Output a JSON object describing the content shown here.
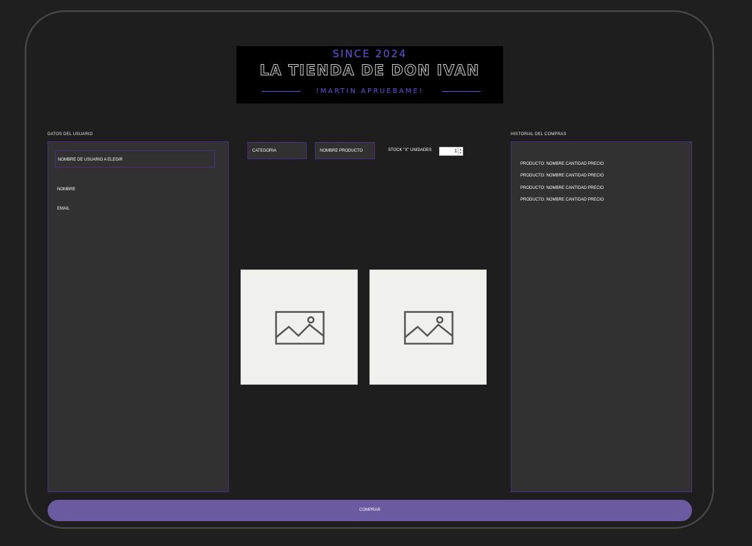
{
  "header": {
    "since": "SINCE 2024",
    "title": "LA TIENDA DE DON IVAN",
    "subtitle": "!MARTIN APRUEBAME!"
  },
  "user_section": {
    "label": "DATOS DEL USUARIO",
    "username_placeholder": "NOMBRE DE USUARIO A ELEGIR",
    "name_label": "NOMBRE",
    "email_label": "EMAIL"
  },
  "product_filters": {
    "category_label": "CATEGORIA",
    "product_label": "NOMBRE PRODUCTO",
    "stock_label": "STOCK \"X\" UNIDADES",
    "quantity_value": "1"
  },
  "product_images": [
    {
      "icon": "image-placeholder-icon"
    },
    {
      "icon": "image-placeholder-icon"
    }
  ],
  "history_section": {
    "label": "HISTORIAL DEL COMPRAS",
    "items": [
      "PRODUCTO: NOMBRE CANTIDAD PRECIO",
      "PRODUCTO: NOMBRE CANTIDAD PRECIO",
      "PRODUCTO: NOMBRE CANTIDAD PRECIO",
      "PRODUCTO: NOMBRE CANTIDAD PRECIO"
    ]
  },
  "actions": {
    "buy_label": "COMPRAR"
  },
  "colors": {
    "accent": "#6a4fe0",
    "panel_border": "#4b2f86",
    "button": "#6a5aa0",
    "panel_bg": "#313131"
  }
}
